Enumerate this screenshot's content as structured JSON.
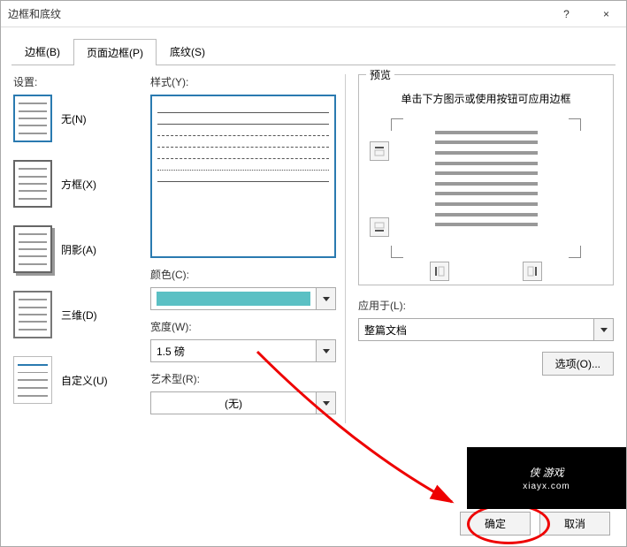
{
  "title": "边框和底纹",
  "titlebar": {
    "help": "?",
    "close": "×"
  },
  "tabs": {
    "borders": "边框(B)",
    "page_borders": "页面边框(P)",
    "shading": "底纹(S)"
  },
  "settings": {
    "label": "设置:",
    "none": "无(N)",
    "box": "方框(X)",
    "shadow": "阴影(A)",
    "threeD": "三维(D)",
    "custom": "自定义(U)"
  },
  "style": {
    "label": "样式(Y):",
    "color_label": "颜色(C):",
    "color_value": "#5bc0c4",
    "width_label": "宽度(W):",
    "width_value": "1.5 磅",
    "art_label": "艺术型(R):",
    "art_value": "(无)"
  },
  "preview": {
    "label": "预览",
    "hint": "单击下方图示或使用按钮可应用边框"
  },
  "apply": {
    "label": "应用于(L):",
    "value": "整篇文档",
    "options": "选项(O)..."
  },
  "buttons": {
    "ok": "确定",
    "cancel": "取消"
  },
  "watermark": {
    "main": "侠 游戏",
    "sub": "xiayx.com"
  }
}
